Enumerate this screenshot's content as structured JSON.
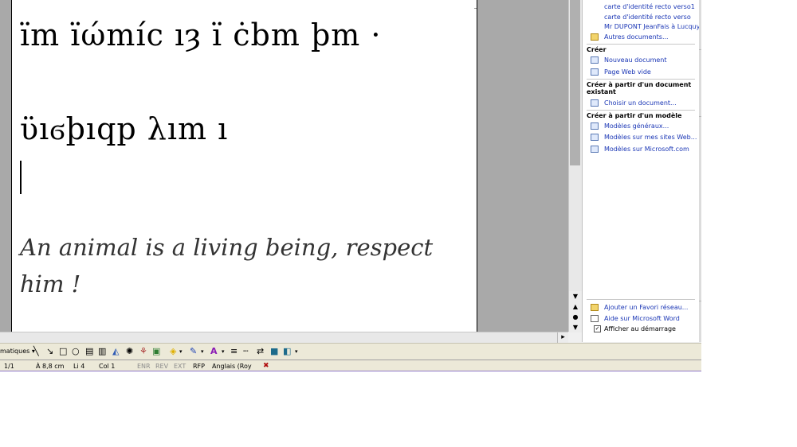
{
  "document": {
    "elvish_line_1": "ïm ïώmíc ıȝ ï ċbm þm ·",
    "elvish_line_2": "ϋıϭþıqp λım ı",
    "english_text": "An animal is a living being, respect him !"
  },
  "task_pane": {
    "open_items": [
      "carte d'identité recto verso1",
      "carte d'identité recto verso",
      "Mr DUPONT JeanFais à Lucquy",
      "Autres documents..."
    ],
    "creer_heading": "Créer",
    "creer_items": [
      "Nouveau document",
      "Page Web vide"
    ],
    "from_existing_heading": "Créer à partir d'un document existant",
    "from_existing_item": "Choisir un document...",
    "from_template_heading": "Créer à partir d'un modèle",
    "template_items": [
      "Modèles généraux...",
      "Modèles sur mes sites Web...",
      "Modèles sur Microsoft.com"
    ],
    "bottom_items": [
      "Ajouter un Favori réseau...",
      "Aide sur Microsoft Word"
    ],
    "show_at_startup": "Afficher au démarrage"
  },
  "drawing_toolbar": {
    "autoshapes_label": "matiques ▾"
  },
  "status_bar": {
    "page": "1/1",
    "position": "À 8,8 cm",
    "line": "Li 4",
    "column": "Col 1",
    "enr": "ENR",
    "rev": "REV",
    "ext": "EXT",
    "rfp": "RFP",
    "language": "Anglais (Roy"
  },
  "colors": {
    "link": "#1a36b5",
    "page_background": "#a9a9a9"
  }
}
